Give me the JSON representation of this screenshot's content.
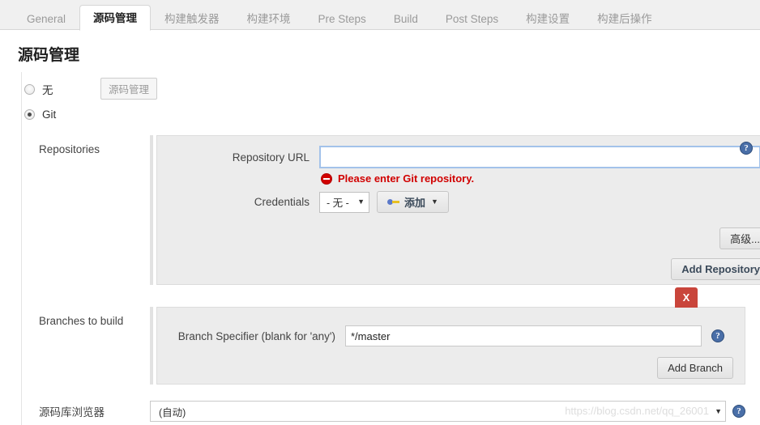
{
  "tabs": [
    {
      "label": "General",
      "active": false
    },
    {
      "label": "源码管理",
      "active": true
    },
    {
      "label": "构建触发器",
      "active": false
    },
    {
      "label": "构建环境",
      "active": false
    },
    {
      "label": "Pre Steps",
      "active": false
    },
    {
      "label": "Build",
      "active": false
    },
    {
      "label": "Post Steps",
      "active": false
    },
    {
      "label": "构建设置",
      "active": false
    },
    {
      "label": "构建后操作",
      "active": false
    }
  ],
  "page": {
    "title": "源码管理"
  },
  "scm_choice": {
    "none_label": "无",
    "git_label": "Git",
    "chip_label": "源码管理"
  },
  "repositories": {
    "section_label": "Repositories",
    "url_label": "Repository URL",
    "url_value": "",
    "url_error": "Please enter Git repository.",
    "credentials_label": "Credentials",
    "credentials_value": "- 无 -",
    "add_credentials_label": "添加",
    "advanced_label": "高级...",
    "add_repository_label": "Add Repository",
    "help_icon_label": "?"
  },
  "branches": {
    "section_label": "Branches to build",
    "specifier_label": "Branch Specifier (blank for 'any')",
    "specifier_value": "*/master",
    "delete_label": "X",
    "add_branch_label": "Add Branch",
    "help_icon_label": "?"
  },
  "repository_browser": {
    "label": "源码库浏览器",
    "value": "(自动)",
    "help_icon_label": "?"
  },
  "watermark": {
    "text": "https://blog.csdn.net/qq_26001"
  },
  "colors": {
    "accent_blue": "#4a6fa8",
    "error_red": "#d10000",
    "delete_red": "#c9453b",
    "panel_bg": "#ececec",
    "tabbar_bg": "#f0f0f0"
  }
}
